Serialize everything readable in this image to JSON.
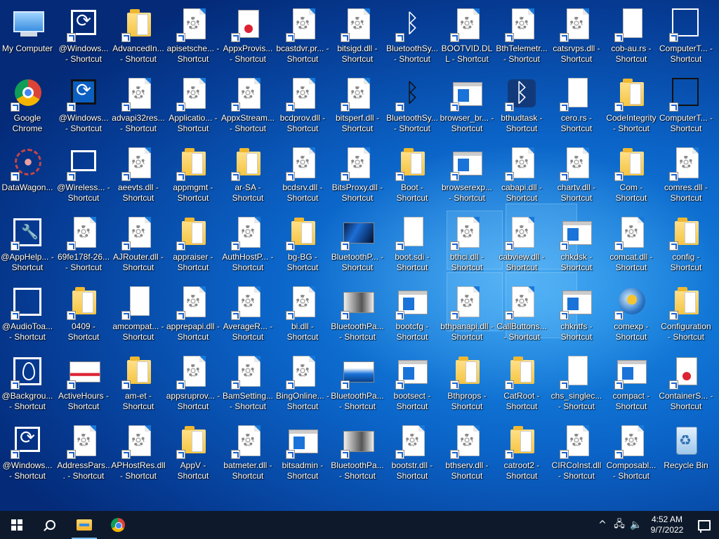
{
  "desktop": {
    "columns": [
      [
        {
          "label": "My Computer",
          "type": "computer",
          "shortcut": false
        },
        {
          "label": "Google Chrome",
          "type": "chrome",
          "shortcut": true
        },
        {
          "label": "DataWagon...",
          "type": "flower",
          "shortcut": true
        },
        {
          "label": "@AppHelp... - Shortcut",
          "type": "wrench",
          "shortcut": true
        },
        {
          "label": "@AudioToa... - Shortcut",
          "type": "speaker",
          "shortcut": true
        },
        {
          "label": "@Backgrou... - Shortcut",
          "type": "leaf",
          "shortcut": true
        },
        {
          "label": "@Windows... - Shortcut",
          "type": "sync",
          "shortcut": true
        }
      ],
      [
        {
          "label": "@Windows... - Shortcut",
          "type": "sync",
          "shortcut": true
        },
        {
          "label": "@Windows... - Shortcut",
          "type": "sync-dark",
          "shortcut": true
        },
        {
          "label": "@Wireless... - Shortcut",
          "type": "cast",
          "shortcut": true
        },
        {
          "label": "69fe178f-26... - Shortcut",
          "type": "gear",
          "shortcut": true
        },
        {
          "label": "0409 - Shortcut",
          "type": "folder",
          "shortcut": true
        },
        {
          "label": "ActiveHours - Shortcut",
          "type": "photo-person",
          "shortcut": true
        },
        {
          "label": "AddressPars... - Shortcut",
          "type": "gear",
          "shortcut": true
        }
      ],
      [
        {
          "label": "AdvancedIn... - Shortcut",
          "type": "folder",
          "shortcut": true
        },
        {
          "label": "advapi32res... - Shortcut",
          "type": "gear",
          "shortcut": true
        },
        {
          "label": "aeevts.dll - Shortcut",
          "type": "gear",
          "shortcut": true
        },
        {
          "label": "AJRouter.dll - Shortcut",
          "type": "gear",
          "shortcut": true
        },
        {
          "label": "amcompat... - Shortcut",
          "type": "blank",
          "shortcut": true
        },
        {
          "label": "am-et - Shortcut",
          "type": "folder",
          "shortcut": true
        },
        {
          "label": "APHostRes.dll - Shortcut",
          "type": "gear",
          "shortcut": true
        }
      ],
      [
        {
          "label": "apisetsche... - Shortcut",
          "type": "gear",
          "shortcut": true
        },
        {
          "label": "Applicatio... - Shortcut",
          "type": "gear",
          "shortcut": true
        },
        {
          "label": "appmgmt - Shortcut",
          "type": "folder",
          "shortcut": true
        },
        {
          "label": "appraiser - Shortcut",
          "type": "folder",
          "shortcut": true
        },
        {
          "label": "apprepapi.dll - Shortcut",
          "type": "gear",
          "shortcut": true
        },
        {
          "label": "appsruprov... - Shortcut",
          "type": "gear",
          "shortcut": true
        },
        {
          "label": "AppV - Shortcut",
          "type": "folder",
          "shortcut": true
        }
      ],
      [
        {
          "label": "AppxProvis... - Shortcut",
          "type": "cert",
          "shortcut": true
        },
        {
          "label": "AppxStream... - Shortcut",
          "type": "gear",
          "shortcut": true
        },
        {
          "label": "ar-SA - Shortcut",
          "type": "folder",
          "shortcut": true
        },
        {
          "label": "AuthHostP... - Shortcut",
          "type": "gear",
          "shortcut": true
        },
        {
          "label": "AverageR... - Shortcut",
          "type": "gear",
          "shortcut": true
        },
        {
          "label": "BamSetting... - Shortcut",
          "type": "gear",
          "shortcut": true
        },
        {
          "label": "batmeter.dll - Shortcut",
          "type": "gear",
          "shortcut": true
        }
      ],
      [
        {
          "label": "bcastdvr.pr... - Shortcut",
          "type": "gear",
          "shortcut": true
        },
        {
          "label": "bcdprov.dll - Shortcut",
          "type": "gear",
          "shortcut": true
        },
        {
          "label": "bcdsrv.dll - Shortcut",
          "type": "gear",
          "shortcut": true
        },
        {
          "label": "bg-BG - Shortcut",
          "type": "folder",
          "shortcut": true
        },
        {
          "label": "bi.dll - Shortcut",
          "type": "gear",
          "shortcut": true
        },
        {
          "label": "BingOnline... - Shortcut",
          "type": "gear",
          "shortcut": true
        },
        {
          "label": "bitsadmin - Shortcut",
          "type": "win",
          "shortcut": true
        }
      ],
      [
        {
          "label": "bitsigd.dll - Shortcut",
          "type": "gear",
          "shortcut": true
        },
        {
          "label": "bitsperf.dll - Shortcut",
          "type": "gear",
          "shortcut": true
        },
        {
          "label": "BitsProxy.dll - Shortcut",
          "type": "gear",
          "shortcut": true
        },
        {
          "label": "BluetoothP... - Shortcut",
          "type": "photo-dark",
          "shortcut": true
        },
        {
          "label": "BluetoothPa... - Shortcut",
          "type": "photo",
          "shortcut": true
        },
        {
          "label": "BluetoothPa... - Shortcut",
          "type": "photo-blue",
          "shortcut": true
        },
        {
          "label": "BluetoothPa... - Shortcut",
          "type": "photo",
          "shortcut": true
        }
      ],
      [
        {
          "label": "BluetoothSy... - Shortcut",
          "type": "bt",
          "shortcut": true
        },
        {
          "label": "BluetoothSy... - Shortcut",
          "type": "bt-dark",
          "shortcut": true
        },
        {
          "label": "Boot - Shortcut",
          "type": "folder",
          "shortcut": true
        },
        {
          "label": "boot.sdi - Shortcut",
          "type": "blank",
          "shortcut": true
        },
        {
          "label": "bootcfg - Shortcut",
          "type": "win",
          "shortcut": true
        },
        {
          "label": "bootsect - Shortcut",
          "type": "win",
          "shortcut": true
        },
        {
          "label": "bootstr.dll - Shortcut",
          "type": "gear",
          "shortcut": true
        }
      ],
      [
        {
          "label": "BOOTVID.DLL - Shortcut",
          "type": "gear",
          "shortcut": true
        },
        {
          "label": "browser_br... - Shortcut",
          "type": "win",
          "shortcut": true
        },
        {
          "label": "browserexp... - Shortcut",
          "type": "win",
          "shortcut": true
        },
        {
          "label": "bthci.dll - Shortcut",
          "type": "gear",
          "shortcut": true
        },
        {
          "label": "bthpanapi.dll - Shortcut",
          "type": "gear",
          "shortcut": true
        },
        {
          "label": "Bthprops - Shortcut",
          "type": "folder",
          "shortcut": true
        },
        {
          "label": "bthserv.dll - Shortcut",
          "type": "gear",
          "shortcut": true
        }
      ],
      [
        {
          "label": "BthTelemetr... - Shortcut",
          "type": "gear",
          "shortcut": true
        },
        {
          "label": "bthudtask - Shortcut",
          "type": "bt-sq",
          "shortcut": true
        },
        {
          "label": "cabapi.dll - Shortcut",
          "type": "gear",
          "shortcut": true
        },
        {
          "label": "cabview.dll - Shortcut",
          "type": "gear",
          "shortcut": true
        },
        {
          "label": "CallButtons... - Shortcut",
          "type": "gear",
          "shortcut": true
        },
        {
          "label": "CatRoot - Shortcut",
          "type": "folder",
          "shortcut": true
        },
        {
          "label": "catroot2 - Shortcut",
          "type": "folder",
          "shortcut": true
        }
      ],
      [
        {
          "label": "catsrvps.dll - Shortcut",
          "type": "gear",
          "shortcut": true
        },
        {
          "label": "cero.rs - Shortcut",
          "type": "blank",
          "shortcut": true
        },
        {
          "label": "chartv.dll - Shortcut",
          "type": "gear",
          "shortcut": true
        },
        {
          "label": "chkdsk - Shortcut",
          "type": "win",
          "shortcut": true
        },
        {
          "label": "chkntfs - Shortcut",
          "type": "win",
          "shortcut": true
        },
        {
          "label": "chs_singlec... - Shortcut",
          "type": "blank",
          "shortcut": true
        },
        {
          "label": "CIRCoInst.dll - Shortcut",
          "type": "gear",
          "shortcut": true
        }
      ],
      [
        {
          "label": "cob-au.rs - Shortcut",
          "type": "blank",
          "shortcut": true
        },
        {
          "label": "CodeIntegrity - Shortcut",
          "type": "folder",
          "shortcut": true
        },
        {
          "label": "Com - Shortcut",
          "type": "folder",
          "shortcut": true
        },
        {
          "label": "comcat.dll - Shortcut",
          "type": "gear",
          "shortcut": true
        },
        {
          "label": "comexp - Shortcut",
          "type": "globe",
          "shortcut": true
        },
        {
          "label": "compact - Shortcut",
          "type": "win",
          "shortcut": true
        },
        {
          "label": "Composabl... - Shortcut",
          "type": "gear",
          "shortcut": true
        }
      ],
      [
        {
          "label": "ComputerT... - Shortcut",
          "type": "network",
          "shortcut": true
        },
        {
          "label": "ComputerT... - Shortcut",
          "type": "network-dark",
          "shortcut": true
        },
        {
          "label": "comres.dll - Shortcut",
          "type": "gear",
          "shortcut": true
        },
        {
          "label": "config - Shortcut",
          "type": "folder",
          "shortcut": true
        },
        {
          "label": "Configuration - Shortcut",
          "type": "folder",
          "shortcut": true
        },
        {
          "label": "ContainerS... - Shortcut",
          "type": "cert",
          "shortcut": true
        },
        {
          "label": "Recycle Bin",
          "type": "recycle",
          "shortcut": false
        }
      ]
    ]
  },
  "taskbar": {
    "start_icon": "windows-start-icon",
    "search_icon": "search-icon",
    "pinned": [
      {
        "name": "file-explorer-icon",
        "active": true
      },
      {
        "name": "chrome-icon",
        "active": false
      }
    ],
    "tray": {
      "chevron": "^",
      "network_icon": "network-icon",
      "volume_icon": "volume-icon",
      "time": "4:52 AM",
      "date": "9/7/2022",
      "notification_icon": "notification-icon"
    }
  }
}
